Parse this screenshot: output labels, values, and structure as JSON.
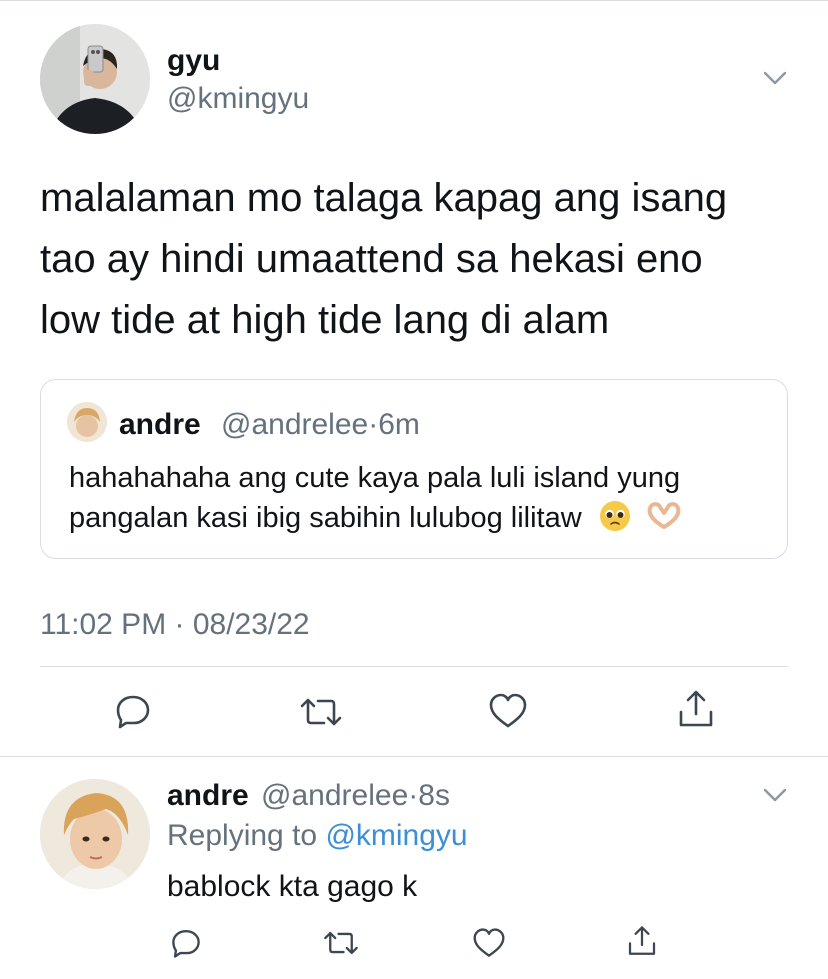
{
  "tweet": {
    "author": {
      "name": "gyu",
      "handle": "@kmingyu"
    },
    "text_lines": [
      "malalaman mo talaga kapag ang isang",
      "tao ay hindi umaattend sa hekasi eno",
      "low tide at high tide lang di alam"
    ],
    "quote": {
      "name": "andre",
      "handle": "@andrelee",
      "time": "6m",
      "text_lines": [
        "hahahahaha ang cute kaya pala luli island yung",
        "pangalan kasi ibig sabihin lulubog lilitaw"
      ],
      "emojis": [
        "🥹",
        "🫶🏻"
      ]
    },
    "timestamp": "11:02 PM · 08/23/22",
    "actions": [
      "reply-icon",
      "retweet-icon",
      "like-icon",
      "share-icon"
    ]
  },
  "reply": {
    "author": {
      "name": "andre",
      "handle": "@andrelee",
      "time": "8s"
    },
    "replying_to_label": "Replying to",
    "replying_to_handle": "@kmingyu",
    "text": "bablock kta gago k",
    "actions": [
      "reply-icon",
      "retweet-icon",
      "like-icon",
      "share-icon"
    ]
  },
  "colors": {
    "text": "#0f1419",
    "muted": "#65717c",
    "link": "#3a8fd6",
    "border": "#d9dde1"
  }
}
